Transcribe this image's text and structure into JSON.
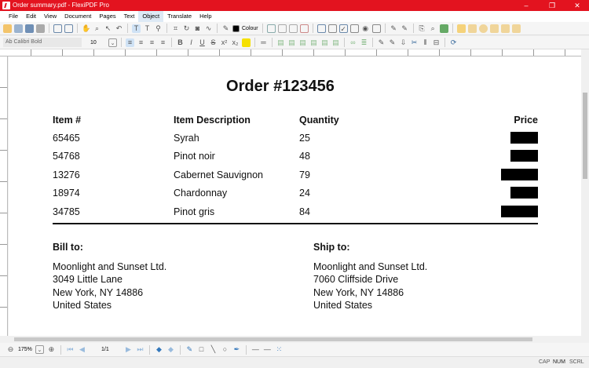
{
  "window": {
    "title": "Order summary.pdf - FlexiPDF Pro",
    "minimize": "–",
    "restore": "❐",
    "close": "✕"
  },
  "menu": [
    "File",
    "Edit",
    "View",
    "Document",
    "Pages",
    "Text",
    "Object",
    "Translate",
    "Help"
  ],
  "toolbar": {
    "colour_label": "Colour",
    "font_name": "Ab Calibri Bold",
    "font_size": "10"
  },
  "document": {
    "title": "Order #123456",
    "headers": [
      "Item #",
      "Item Description",
      "Quantity",
      "Price"
    ],
    "rows": [
      {
        "item": "65465",
        "desc": "Syrah",
        "qty": "25"
      },
      {
        "item": "54768",
        "desc": "Pinot noir",
        "qty": "48"
      },
      {
        "item": "13276",
        "desc": "Cabernet Sauvignon",
        "qty": "79"
      },
      {
        "item": "18974",
        "desc": "Chardonnay",
        "qty": "24"
      },
      {
        "item": "34785",
        "desc": "Pinot gris",
        "qty": "84"
      }
    ],
    "bill_to": {
      "label": "Bill to:",
      "lines": [
        "Moonlight and Sunset Ltd.",
        "3049 Little Lane",
        "New York, NY 14886",
        "United States"
      ]
    },
    "ship_to": {
      "label": "Ship to:",
      "lines": [
        "Moonlight and Sunset Ltd.",
        "7060 Cliffside Drive",
        "New York, NY 14886",
        "United States"
      ]
    }
  },
  "bottom": {
    "zoom": "175%",
    "page": "1/1"
  },
  "status": {
    "cap": "CAP",
    "num": "NUM",
    "scrl": "SCRL"
  }
}
